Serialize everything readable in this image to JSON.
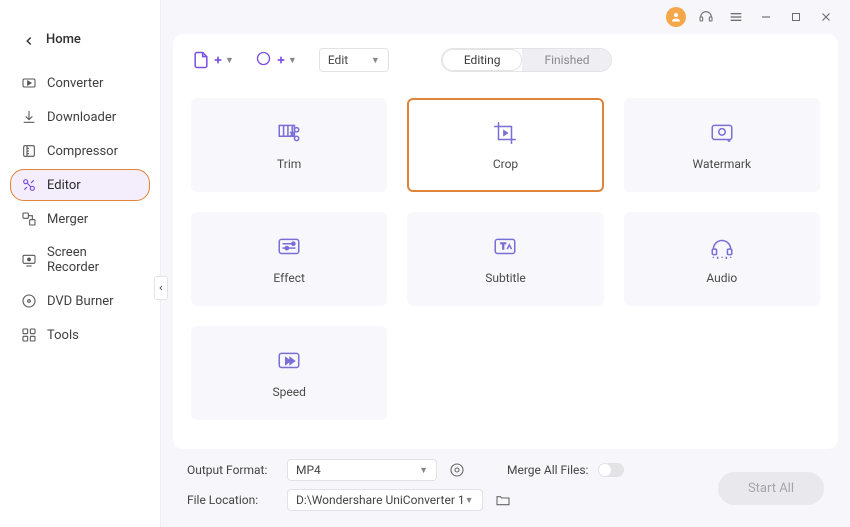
{
  "home_label": "Home",
  "sidebar": {
    "items": [
      {
        "label": "Converter"
      },
      {
        "label": "Downloader"
      },
      {
        "label": "Compressor"
      },
      {
        "label": "Editor"
      },
      {
        "label": "Merger"
      },
      {
        "label": "Screen Recorder"
      },
      {
        "label": "DVD Burner"
      },
      {
        "label": "Tools"
      }
    ]
  },
  "toolbar": {
    "mode_dropdown": "Edit",
    "segment_editing": "Editing",
    "segment_finished": "Finished"
  },
  "tiles": {
    "trim": "Trim",
    "crop": "Crop",
    "watermark": "Watermark",
    "effect": "Effect",
    "subtitle": "Subtitle",
    "audio": "Audio",
    "speed": "Speed"
  },
  "footer": {
    "output_label": "Output Format:",
    "output_value": "MP4",
    "location_label": "File Location:",
    "location_value": "D:\\Wondershare UniConverter 1",
    "merge_label": "Merge All Files:",
    "start_all": "Start All"
  }
}
